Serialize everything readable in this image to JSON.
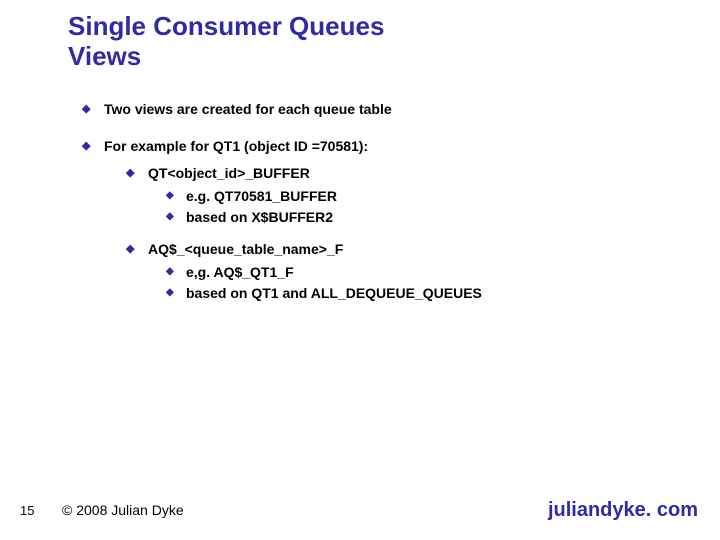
{
  "title_line1": "Single Consumer Queues",
  "title_line2": "Views",
  "bullets": {
    "b1": "Two views are created for each queue table",
    "b2": "For example for QT1 (object ID =70581):",
    "b2_sub": {
      "s1": "QT<object_id>_BUFFER",
      "s1_sub": {
        "a": "e.g. QT70581_BUFFER",
        "b": "based on X$BUFFER2"
      },
      "s2": "AQ$_<queue_table_name>_F",
      "s2_sub": {
        "a": "e,g. AQ$_QT1_F",
        "b": "based on QT1 and ALL_DEQUEUE_QUEUES"
      }
    }
  },
  "footer": {
    "page": "15",
    "copyright": "© 2008 Julian Dyke",
    "site": "juliandyke. com"
  }
}
